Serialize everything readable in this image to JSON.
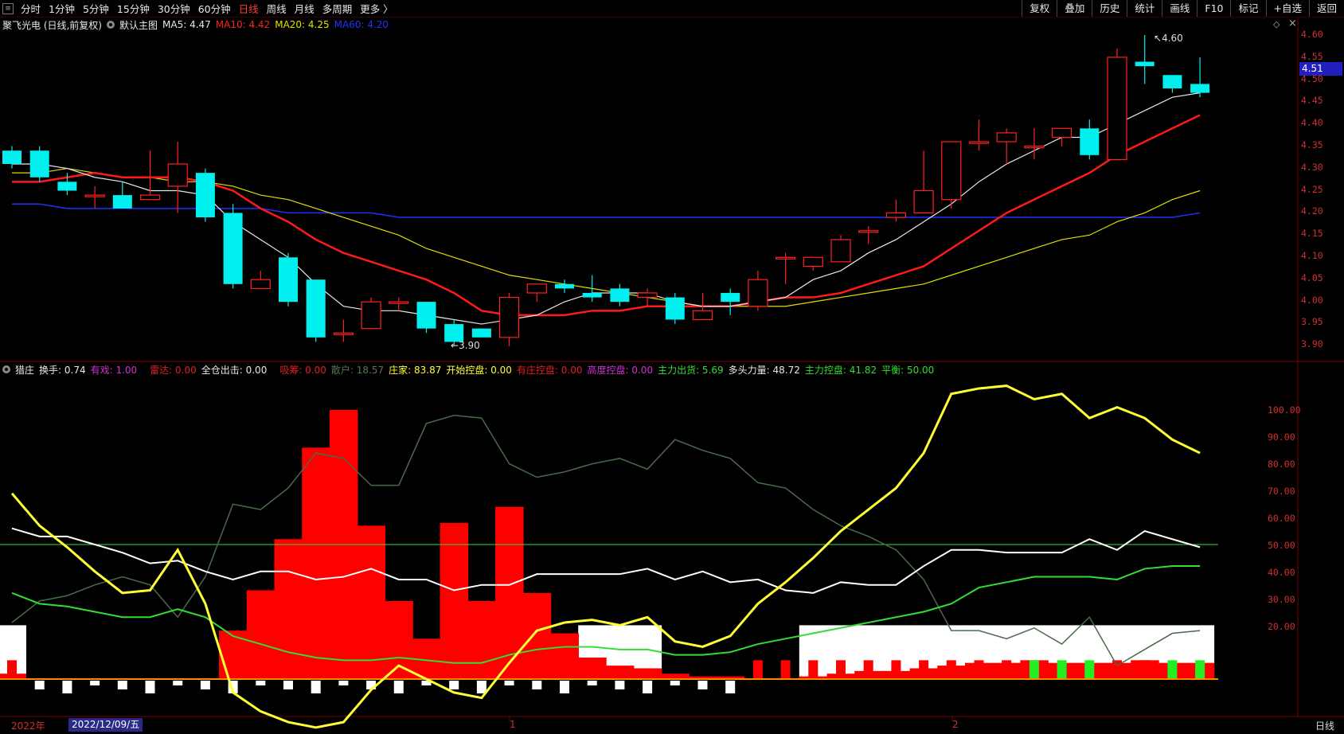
{
  "toolbar": {
    "periods": [
      "分时",
      "1分钟",
      "5分钟",
      "15分钟",
      "30分钟",
      "60分钟",
      "日线",
      "周线",
      "月线",
      "多周期",
      "更多 〉"
    ],
    "active_period": "日线",
    "tools": [
      "复权",
      "叠加",
      "历史",
      "统计",
      "画线",
      "F10",
      "标记",
      "+自选",
      "返回"
    ]
  },
  "main_legend": {
    "stock": "聚飞光电 (日线,前复权)",
    "indicator": "默认主图",
    "ma5": "MA5: 4.47",
    "ma10": "MA10: 4.42",
    "ma20": "MA20: 4.25",
    "ma60": "MA60: 4.20"
  },
  "indicator_legend": {
    "name": "猎庄",
    "items": [
      {
        "text": "换手: 0.74",
        "color": "#e8e8e8"
      },
      {
        "text": "有戏: 1.00",
        "color": "#d030d0"
      },
      {
        "text": "雷达: 0.00",
        "color": "#e02020"
      },
      {
        "text": "全仓出击: 0.00",
        "color": "#e8e8e8"
      },
      {
        "text": "吸筹: 0.00",
        "color": "#e02020"
      },
      {
        "text": "散户: 18.57",
        "color": "#557755"
      },
      {
        "text": "庄家: 83.87",
        "color": "#ffff33"
      },
      {
        "text": "开始控盘: 0.00",
        "color": "#ffff33"
      },
      {
        "text": "有庄控盘: 0.00",
        "color": "#e02020"
      },
      {
        "text": "高度控盘: 0.00",
        "color": "#d030d0"
      },
      {
        "text": "主力出货: 5.69",
        "color": "#33dd33"
      },
      {
        "text": "多头力量: 48.72",
        "color": "#e8e8e8"
      },
      {
        "text": "主力控盘: 41.82",
        "color": "#33dd33"
      },
      {
        "text": "平衡: 50.00",
        "color": "#33dd33"
      }
    ]
  },
  "price_axis": [
    "4.60",
    "4.55",
    "4.50",
    "4.45",
    "4.40",
    "4.35",
    "4.30",
    "4.25",
    "4.20",
    "4.15",
    "4.10",
    "4.05",
    "4.00",
    "3.95",
    "3.90"
  ],
  "indicator_axis": [
    "100.00",
    "90.00",
    "80.00",
    "70.00",
    "60.00",
    "50.00",
    "40.00",
    "30.00",
    "20.00"
  ],
  "current_price": "4.51",
  "high_annotation": "4.60",
  "low_annotation": "3.90",
  "x_axis": {
    "year": "2022年",
    "date_chip": "2022/12/09/五",
    "mark1": "1",
    "mark2": "2",
    "period_label": "日线"
  },
  "colors": {
    "up": "#ff2020",
    "down": "#00f0f0",
    "ma5": "#e8e8e8",
    "ma10": "#ff1a1a",
    "ma20": "#e0e000",
    "ma60": "#2030ff"
  },
  "chart_data": [
    {
      "type": "candlestick",
      "title": "聚飞光电 (日线,前复权)",
      "ylim": [
        3.88,
        4.62
      ],
      "candles": [
        [
          4.34,
          4.31,
          4.35,
          4.3
        ],
        [
          4.34,
          4.28,
          4.35,
          4.27
        ],
        [
          4.27,
          4.25,
          4.29,
          4.24
        ],
        [
          4.24,
          4.24,
          4.26,
          4.21
        ],
        [
          4.24,
          4.21,
          4.27,
          4.21
        ],
        [
          4.23,
          4.24,
          4.34,
          4.23
        ],
        [
          4.26,
          4.31,
          4.36,
          4.2
        ],
        [
          4.29,
          4.19,
          4.3,
          4.18
        ],
        [
          4.2,
          4.04,
          4.22,
          4.03
        ],
        [
          4.03,
          4.05,
          4.07,
          4.03
        ],
        [
          4.1,
          4.0,
          4.11,
          3.99
        ],
        [
          4.05,
          3.92,
          4.05,
          3.91
        ],
        [
          3.93,
          3.93,
          3.96,
          3.91
        ],
        [
          3.94,
          4.0,
          4.01,
          3.94
        ],
        [
          4.0,
          4.0,
          4.01,
          3.98
        ],
        [
          4.0,
          3.94,
          4.0,
          3.93
        ],
        [
          3.95,
          3.91,
          3.96,
          3.9
        ],
        [
          3.94,
          3.92,
          3.94,
          3.92
        ],
        [
          3.92,
          4.01,
          4.02,
          3.9
        ],
        [
          4.02,
          4.04,
          4.04,
          4.0
        ],
        [
          4.04,
          4.03,
          4.05,
          4.02
        ],
        [
          4.02,
          4.01,
          4.06,
          4.0
        ],
        [
          4.03,
          4.0,
          4.04,
          3.99
        ],
        [
          4.01,
          4.02,
          4.03,
          3.99
        ],
        [
          4.01,
          3.96,
          4.02,
          3.95
        ],
        [
          3.96,
          3.98,
          4.02,
          3.96
        ],
        [
          4.02,
          4.0,
          4.03,
          3.97
        ],
        [
          3.99,
          4.05,
          4.07,
          3.98
        ],
        [
          4.1,
          4.1,
          4.11,
          4.04
        ],
        [
          4.08,
          4.1,
          4.1,
          4.07
        ],
        [
          4.09,
          4.14,
          4.15,
          4.09
        ],
        [
          4.16,
          4.16,
          4.17,
          4.13
        ],
        [
          4.19,
          4.2,
          4.23,
          4.18
        ],
        [
          4.2,
          4.25,
          4.34,
          4.2
        ],
        [
          4.23,
          4.36,
          4.36,
          4.21
        ],
        [
          4.36,
          4.36,
          4.41,
          4.34
        ],
        [
          4.36,
          4.38,
          4.39,
          4.31
        ],
        [
          4.35,
          4.35,
          4.39,
          4.32
        ],
        [
          4.37,
          4.39,
          4.39,
          4.35
        ],
        [
          4.39,
          4.33,
          4.41,
          4.32
        ],
        [
          4.32,
          4.55,
          4.57,
          4.32
        ],
        [
          4.54,
          4.53,
          4.6,
          4.49
        ],
        [
          4.51,
          4.48,
          4.51,
          4.47
        ],
        [
          4.49,
          4.47,
          4.55,
          4.46
        ]
      ],
      "ma5": [
        4.31,
        4.31,
        4.3,
        4.28,
        4.27,
        4.25,
        4.25,
        4.24,
        4.18,
        4.14,
        4.1,
        4.04,
        3.99,
        3.98,
        3.98,
        3.97,
        3.96,
        3.95,
        3.96,
        3.97,
        4.0,
        4.02,
        4.02,
        4.02,
        4.0,
        3.99,
        3.99,
        4.0,
        4.01,
        4.05,
        4.07,
        4.11,
        4.14,
        4.18,
        4.22,
        4.27,
        4.31,
        4.34,
        4.37,
        4.37,
        4.4,
        4.43,
        4.46,
        4.47
      ],
      "ma10": [
        4.27,
        4.27,
        4.28,
        4.29,
        4.28,
        4.28,
        4.28,
        4.27,
        4.25,
        4.21,
        4.18,
        4.14,
        4.11,
        4.09,
        4.07,
        4.05,
        4.02,
        3.98,
        3.97,
        3.97,
        3.97,
        3.98,
        3.98,
        3.99,
        3.99,
        3.99,
        3.99,
        4.0,
        4.01,
        4.01,
        4.02,
        4.04,
        4.06,
        4.08,
        4.12,
        4.16,
        4.2,
        4.23,
        4.26,
        4.29,
        4.33,
        4.36,
        4.39,
        4.42
      ],
      "ma20": [
        4.29,
        4.29,
        4.3,
        4.29,
        4.28,
        4.28,
        4.27,
        4.27,
        4.26,
        4.24,
        4.23,
        4.21,
        4.19,
        4.17,
        4.15,
        4.12,
        4.1,
        4.08,
        4.06,
        4.05,
        4.04,
        4.03,
        4.02,
        4.01,
        4.0,
        3.99,
        3.99,
        3.99,
        3.99,
        4.0,
        4.01,
        4.02,
        4.03,
        4.04,
        4.06,
        4.08,
        4.1,
        4.12,
        4.14,
        4.15,
        4.18,
        4.2,
        4.23,
        4.25
      ],
      "ma60": [
        4.22,
        4.22,
        4.21,
        4.21,
        4.21,
        4.21,
        4.21,
        4.21,
        4.21,
        4.21,
        4.2,
        4.2,
        4.2,
        4.2,
        4.19,
        4.19,
        4.19,
        4.19,
        4.19,
        4.19,
        4.19,
        4.19,
        4.19,
        4.19,
        4.19,
        4.19,
        4.19,
        4.19,
        4.19,
        4.19,
        4.19,
        4.19,
        4.19,
        4.19,
        4.19,
        4.19,
        4.19,
        4.19,
        4.19,
        4.19,
        4.19,
        4.19,
        4.19,
        4.2
      ]
    },
    {
      "type": "indicator",
      "title": "猎庄",
      "ylim": [
        0,
        110
      ],
      "zhuangjia": [
        69,
        57,
        49,
        40,
        32,
        33,
        48,
        28,
        -5,
        -12,
        -16,
        -18,
        -16,
        -4,
        5,
        0,
        -5,
        -7,
        6,
        18,
        21,
        22,
        20,
        23,
        14,
        12,
        16,
        28,
        36,
        45,
        55,
        63,
        71,
        84,
        106,
        108,
        109,
        104,
        106,
        97,
        101,
        97,
        89,
        84
      ],
      "sanhu": [
        21,
        29,
        31,
        35,
        38,
        35,
        23,
        38,
        65,
        63,
        71,
        84,
        82,
        72,
        72,
        95,
        98,
        97,
        80,
        75,
        77,
        80,
        82,
        78,
        89,
        85,
        82,
        73,
        71,
        63,
        57,
        53,
        48,
        37,
        18,
        18,
        15,
        19,
        13,
        23,
        5,
        11,
        17,
        18
      ],
      "duotou": [
        56,
        53,
        53,
        50,
        47,
        43,
        44,
        40,
        37,
        40,
        40,
        37,
        38,
        41,
        37,
        37,
        33,
        35,
        35,
        39,
        39,
        39,
        39,
        41,
        37,
        40,
        36,
        37,
        33,
        32,
        36,
        35,
        35,
        42,
        48,
        48,
        47,
        47,
        47,
        52,
        48,
        55,
        52,
        49
      ],
      "kongpan": [
        32,
        28,
        27,
        25,
        23,
        23,
        26,
        23,
        16,
        13,
        10,
        8,
        7,
        7,
        8,
        7,
        6,
        6,
        9,
        11,
        12,
        12,
        11,
        11,
        9,
        9,
        10,
        13,
        15,
        17,
        19,
        21,
        23,
        25,
        28,
        34,
        36,
        38,
        38,
        38,
        37,
        41,
        42,
        42
      ],
      "balance": 50,
      "red_bars": [
        2,
        0,
        0,
        0,
        0,
        0,
        0,
        0,
        18,
        33,
        52,
        86,
        100,
        57,
        29,
        15,
        58,
        29,
        64,
        32,
        17,
        8,
        5,
        4,
        2,
        1,
        1,
        0,
        0,
        1,
        2,
        3,
        3,
        4,
        5,
        6,
        6,
        7,
        6,
        6,
        6,
        7,
        6,
        6
      ],
      "white_columns": [
        1,
        0,
        0,
        0,
        0,
        0,
        0,
        0,
        0,
        0,
        0,
        0,
        0,
        0,
        0,
        0,
        0,
        0,
        0,
        0,
        0,
        1,
        1,
        1,
        0,
        0,
        0,
        0,
        0,
        1,
        1,
        1,
        1,
        1,
        1,
        1,
        1,
        1,
        1,
        1,
        1,
        1,
        1,
        1
      ],
      "small_bar_colors": [
        "r",
        "w",
        "w",
        "w",
        "w",
        "w",
        "w",
        "w",
        "w",
        "w",
        "w",
        "w",
        "w",
        "w",
        "w",
        "w",
        "w",
        "w",
        "w",
        "w",
        "w",
        "w",
        "w",
        "w",
        "w",
        "w",
        "w",
        "r",
        "r",
        "r",
        "r",
        "r",
        "r",
        "r",
        "r",
        "r",
        "r",
        "g",
        "g",
        "g",
        "r",
        "r",
        "g",
        "g"
      ]
    }
  ]
}
